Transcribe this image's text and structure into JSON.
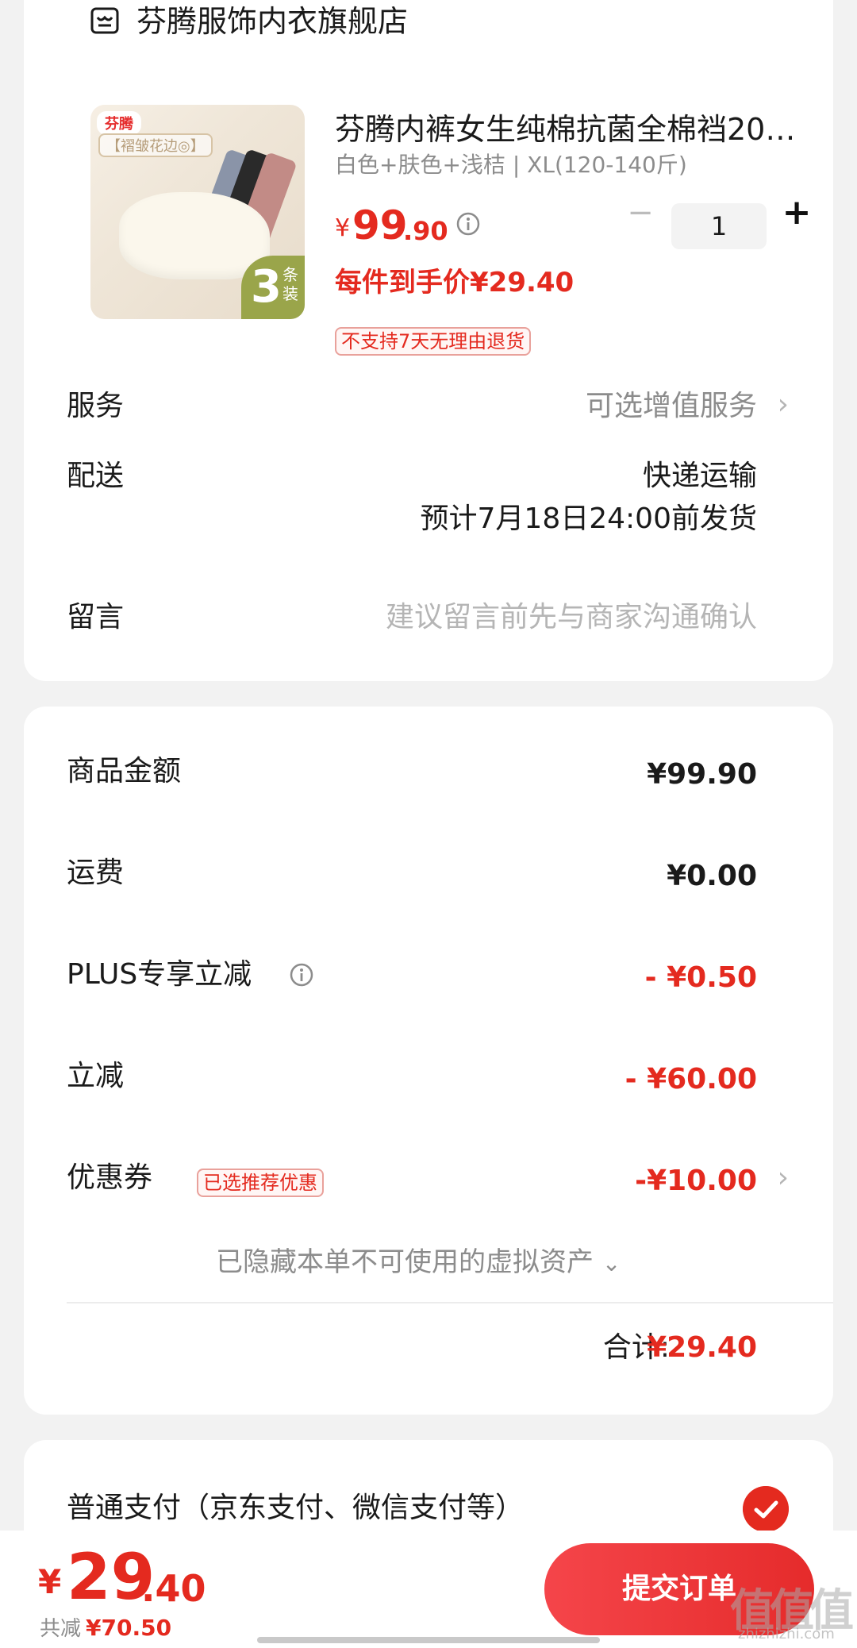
{
  "store": {
    "name": "芬腾服饰内衣旗舰店",
    "icon": "store-icon"
  },
  "product": {
    "title": "芬腾内裤女生纯棉抗菌全棉裆20…",
    "spec": "白色+肤色+浅桔 | XL(120-140斤)",
    "price_symbol": "¥",
    "price_int": "99",
    "price_dec": ".90",
    "quantity": "1",
    "unit_price": "每件到手价¥29.40",
    "no_return_badge": "不支持7天无理由退货",
    "thumb_brand": "芬腾",
    "thumb_tag": "【褶皱花边◎】",
    "thumb_pack_num": "3",
    "thumb_pack_unit": "条装"
  },
  "rows": {
    "service_label": "服务",
    "service_value": "可选增值服务",
    "delivery_label": "配送",
    "delivery_method": "快递运输",
    "delivery_eta": "预计7月18日24:00前发货",
    "note_label": "留言",
    "note_placeholder": "建议留言前先与商家沟通确认"
  },
  "summary": {
    "goods_label": "商品金额",
    "goods_value": "¥99.90",
    "shipping_label": "运费",
    "shipping_value": "¥0.00",
    "plus_label": "PLUS专享立减",
    "plus_value": "- ¥0.50",
    "discount_label": "立减",
    "discount_value": "- ¥60.00",
    "coupon_label": "优惠券",
    "coupon_badge": "已选推荐优惠",
    "coupon_value": "-¥10.00",
    "hidden_assets": "已隐藏本单不可使用的虚拟资产",
    "total_label": "合计:",
    "total_value": "¥29.40"
  },
  "payment": {
    "label": "普通支付（京东支付、微信支付等）"
  },
  "bottom": {
    "price_symbol": "¥",
    "price_int": "29",
    "price_dec": ".40",
    "save_label": "共减",
    "save_value": "¥70.50",
    "submit_label": "提交订单",
    "watermark": "值值值",
    "watermark_sub": "zhizhizhi.com"
  },
  "colors": {
    "accent": "#e42a1f",
    "background": "#f2f2f2"
  }
}
